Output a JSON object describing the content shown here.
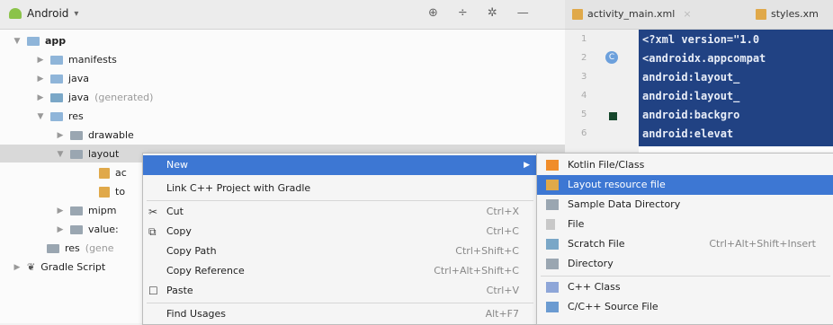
{
  "project_panel": {
    "view_label": "Android",
    "tree": [
      {
        "label": "app"
      },
      {
        "label": "manifests"
      },
      {
        "label": "java"
      },
      {
        "label": "java",
        "suffix": "(generated)"
      },
      {
        "label": "res"
      },
      {
        "label": "drawable"
      },
      {
        "label": "layout"
      },
      {
        "label": "ac"
      },
      {
        "label": "to"
      },
      {
        "label": "mipm"
      },
      {
        "label": "value:"
      },
      {
        "label": "res",
        "suffix": "(gene"
      },
      {
        "label": "Gradle Script"
      }
    ]
  },
  "editor": {
    "tabs": [
      {
        "label": "activity_main.xml"
      },
      {
        "label": "styles.xm"
      }
    ],
    "line_numbers": [
      "1",
      "2",
      "3",
      "4",
      "5",
      "6"
    ],
    "gutter_badge": "C",
    "code_lines": [
      "<?xml version=\"1.0",
      "<androidx.appcompat",
      "    android:layout_",
      "    android:layout_",
      "    android:backgro",
      "    android:elevat"
    ]
  },
  "context_menu": {
    "items": [
      {
        "label": "New"
      },
      {
        "label": "Link C++ Project with Gradle"
      },
      {
        "label": "Cut",
        "shortcut": "Ctrl+X"
      },
      {
        "label": "Copy",
        "shortcut": "Ctrl+C"
      },
      {
        "label": "Copy Path",
        "shortcut": "Ctrl+Shift+C"
      },
      {
        "label": "Copy Reference",
        "shortcut": "Ctrl+Alt+Shift+C"
      },
      {
        "label": "Paste",
        "shortcut": "Ctrl+V"
      },
      {
        "label": "Find Usages",
        "shortcut": "Alt+F7"
      }
    ]
  },
  "new_submenu": {
    "items": [
      {
        "label": "Kotlin File/Class"
      },
      {
        "label": "Layout resource file"
      },
      {
        "label": "Sample Data Directory"
      },
      {
        "label": "File"
      },
      {
        "label": "Scratch File",
        "shortcut": "Ctrl+Alt+Shift+Insert"
      },
      {
        "label": "Directory"
      },
      {
        "label": "C++ Class"
      },
      {
        "label": "C/C++ Source File"
      }
    ]
  },
  "colors": {
    "selection_blue": "#3d77d3",
    "code_selection": "#214283"
  }
}
